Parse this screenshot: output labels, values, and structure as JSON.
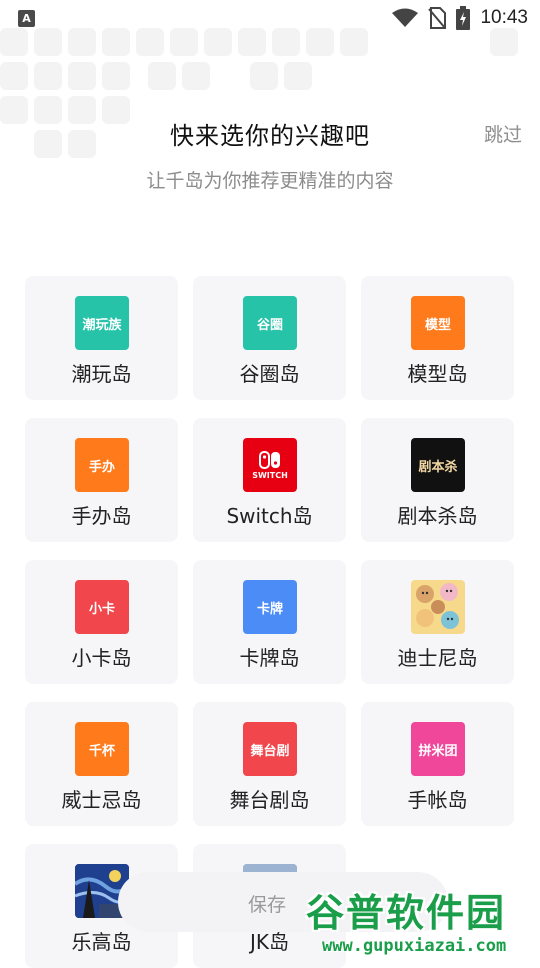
{
  "status_bar": {
    "left_icon": "A",
    "time": "10:43",
    "icons": [
      "wifi-icon",
      "no-sim-icon",
      "battery-charging-icon"
    ]
  },
  "header": {
    "title": "快来选你的兴趣吧",
    "skip": "跳过",
    "subtitle": "让千岛为你推荐更精准的内容"
  },
  "interests": [
    {
      "label": "潮玩岛",
      "logo_text": "潮玩族",
      "logo_color": "#27c3a9"
    },
    {
      "label": "谷圈岛",
      "logo_text": "谷圈",
      "logo_color": "#27c3a9"
    },
    {
      "label": "模型岛",
      "logo_text": "模型",
      "logo_color": "#ff7a1a"
    },
    {
      "label": "手办岛",
      "logo_text": "手办",
      "logo_color": "#ff7a1a"
    },
    {
      "label": "Switch岛",
      "logo_text": "SWITCH",
      "logo_color": "#e60012"
    },
    {
      "label": "剧本杀岛",
      "logo_text": "剧本杀",
      "logo_color": "#111111"
    },
    {
      "label": "小卡岛",
      "logo_text": "小卡",
      "logo_color": "#f0464c"
    },
    {
      "label": "卡牌岛",
      "logo_text": "卡牌",
      "logo_color": "#4c8cf7"
    },
    {
      "label": "迪士尼岛",
      "logo_text": "",
      "logo_color": "#f7d98c"
    },
    {
      "label": "威士忌岛",
      "logo_text": "千杯",
      "logo_color": "#ff7a1a"
    },
    {
      "label": "舞台剧岛",
      "logo_text": "舞台剧",
      "logo_color": "#f0464c"
    },
    {
      "label": "手帐岛",
      "logo_text": "拼米团",
      "logo_color": "#f0479a"
    },
    {
      "label": "乐高岛",
      "logo_text": "",
      "logo_color": "#2b4aa0"
    },
    {
      "label": "JK岛",
      "logo_text": "",
      "logo_color": "#7d9bc4"
    }
  ],
  "save_bar": {
    "label": "保存"
  },
  "watermark": {
    "main": "谷普软件园",
    "url": "www.gupuxiazai.com"
  }
}
